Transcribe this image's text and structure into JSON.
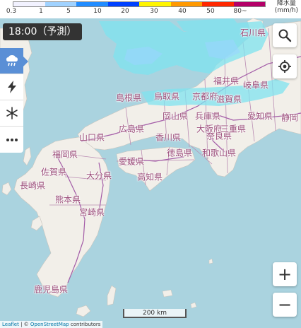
{
  "legend": {
    "ticks": [
      "0.3",
      "1",
      "5",
      "10",
      "20",
      "30",
      "40",
      "50",
      "80~"
    ],
    "colors": [
      "#f2f2ff",
      "#a0d2ff",
      "#218cff",
      "#0041ff",
      "#fff500",
      "#ff9900",
      "#ff2800",
      "#b40068"
    ],
    "unit_line1": "降水量",
    "unit_line2": "(mm/h)"
  },
  "time_badge": "18:00（予測）",
  "layers": [
    {
      "name": "rain-icon",
      "active": true
    },
    {
      "name": "lightning-icon",
      "active": false
    },
    {
      "name": "snow-icon",
      "active": false
    },
    {
      "name": "more-icon",
      "active": false
    }
  ],
  "controls": {
    "zoom_in": "+",
    "zoom_out": "−"
  },
  "scale_label": "200 km",
  "attribution": {
    "leaflet": "Leaflet",
    "sep": " | © ",
    "osm": "OpenStreetMap",
    "rest": " contributors"
  },
  "prefectures": [
    "石川県",
    "福井県",
    "岐阜県",
    "島根県",
    "鳥取県",
    "京都府",
    "滋賀県",
    "愛知県",
    "静岡",
    "岡山県",
    "兵庫県",
    "大阪府",
    "奈良県",
    "三重県",
    "山口県",
    "広島県",
    "香川県",
    "徳島県",
    "和歌山県",
    "福岡県",
    "愛媛県",
    "高知県",
    "佐賀県",
    "大分県",
    "長崎県",
    "熊本県",
    "宮崎県",
    "鹿児島県"
  ]
}
